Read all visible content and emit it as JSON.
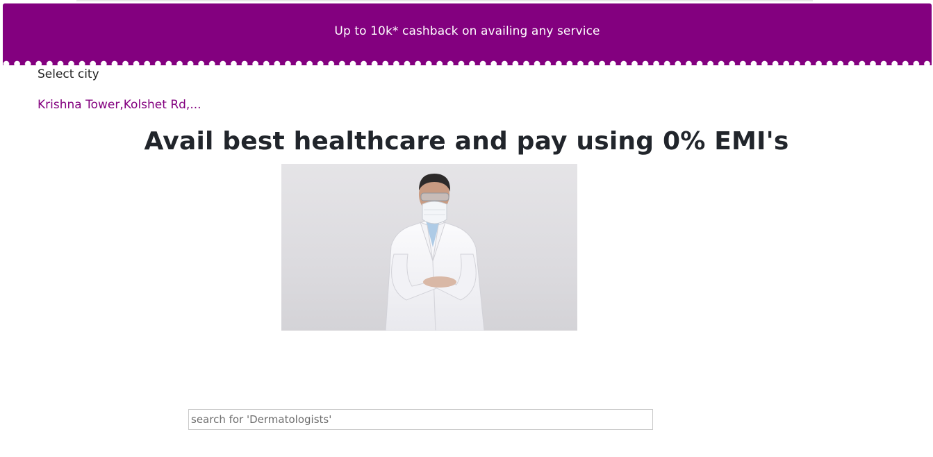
{
  "promo": {
    "text": "Up to 10k* cashback on availing any service"
  },
  "location": {
    "label": "Select city",
    "value": "Krishna Tower,Kolshet Rd,..."
  },
  "hero": {
    "headline": "Avail best healthcare and pay using 0% EMI's",
    "image_icon": "doctor-with-mask-photo"
  },
  "search": {
    "placeholder": "search for 'Dermatologists'",
    "value": ""
  },
  "colors": {
    "brand": "#83007f",
    "banner_text": "#ffffff",
    "headline": "#21252b"
  }
}
